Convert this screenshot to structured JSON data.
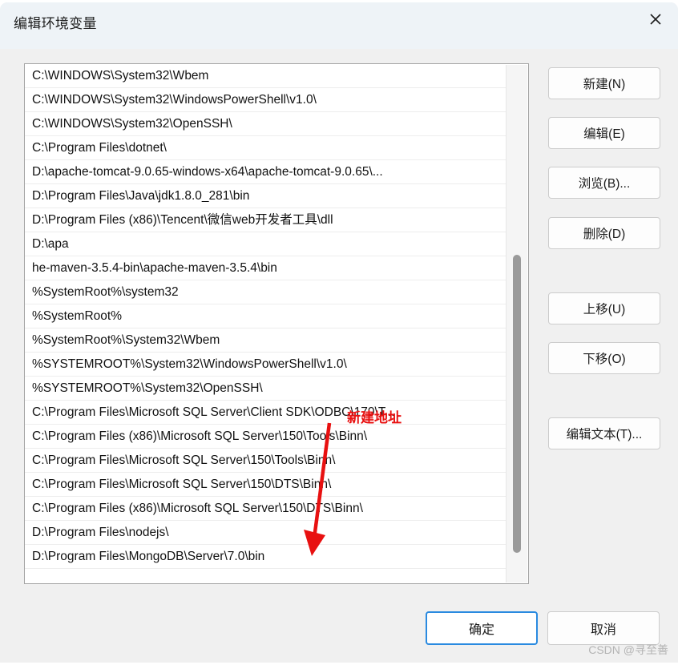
{
  "window": {
    "title": "编辑环境变量",
    "close_icon": "close-icon"
  },
  "list": {
    "selected_index": 21,
    "items": [
      "C:\\WINDOWS\\System32\\Wbem",
      "C:\\WINDOWS\\System32\\WindowsPowerShell\\v1.0\\",
      "C:\\WINDOWS\\System32\\OpenSSH\\",
      "C:\\Program Files\\dotnet\\",
      "D:\\apache-tomcat-9.0.65-windows-x64\\apache-tomcat-9.0.65\\...",
      "D:\\Program Files\\Java\\jdk1.8.0_281\\bin",
      "D:\\Program Files (x86)\\Tencent\\微信web开发者工具\\dll",
      "D:\\apa",
      "he-maven-3.5.4-bin\\apache-maven-3.5.4\\bin",
      "%SystemRoot%\\system32",
      "%SystemRoot%",
      "%SystemRoot%\\System32\\Wbem",
      "%SYSTEMROOT%\\System32\\WindowsPowerShell\\v1.0\\",
      "%SYSTEMROOT%\\System32\\OpenSSH\\",
      "C:\\Program Files\\Microsoft SQL Server\\Client SDK\\ODBC\\170\\T...",
      "C:\\Program Files (x86)\\Microsoft SQL Server\\150\\Tools\\Binn\\",
      "C:\\Program Files\\Microsoft SQL Server\\150\\Tools\\Binn\\",
      "C:\\Program Files\\Microsoft SQL Server\\150\\DTS\\Binn\\",
      "C:\\Program Files (x86)\\Microsoft SQL Server\\150\\DTS\\Binn\\",
      "D:\\Program Files\\nodejs\\",
      "D:\\Program Files\\MongoDB\\Server\\7.0\\bin"
    ]
  },
  "side_buttons": [
    {
      "label": "新建(N)",
      "name": "new-button"
    },
    {
      "label": "编辑(E)",
      "name": "edit-button"
    },
    {
      "label": "浏览(B)...",
      "name": "browse-button"
    },
    {
      "label": "删除(D)",
      "name": "delete-button"
    },
    {
      "label": "上移(U)",
      "name": "move-up-button"
    },
    {
      "label": "下移(O)",
      "name": "move-down-button"
    },
    {
      "label": "编辑文本(T)...",
      "name": "edit-text-button"
    }
  ],
  "bottom_buttons": {
    "ok": "确定",
    "cancel": "取消"
  },
  "annotation": {
    "text": "新建地址",
    "color": "#e81010"
  },
  "watermark": "CSDN @寻至善",
  "colors": {
    "selection": "#0a72d4",
    "dialog_bg": "#f0f0f0",
    "titlebar_bg": "#eef3f7",
    "focus_border": "#2a8ae0",
    "annotation_red": "#e81010"
  }
}
